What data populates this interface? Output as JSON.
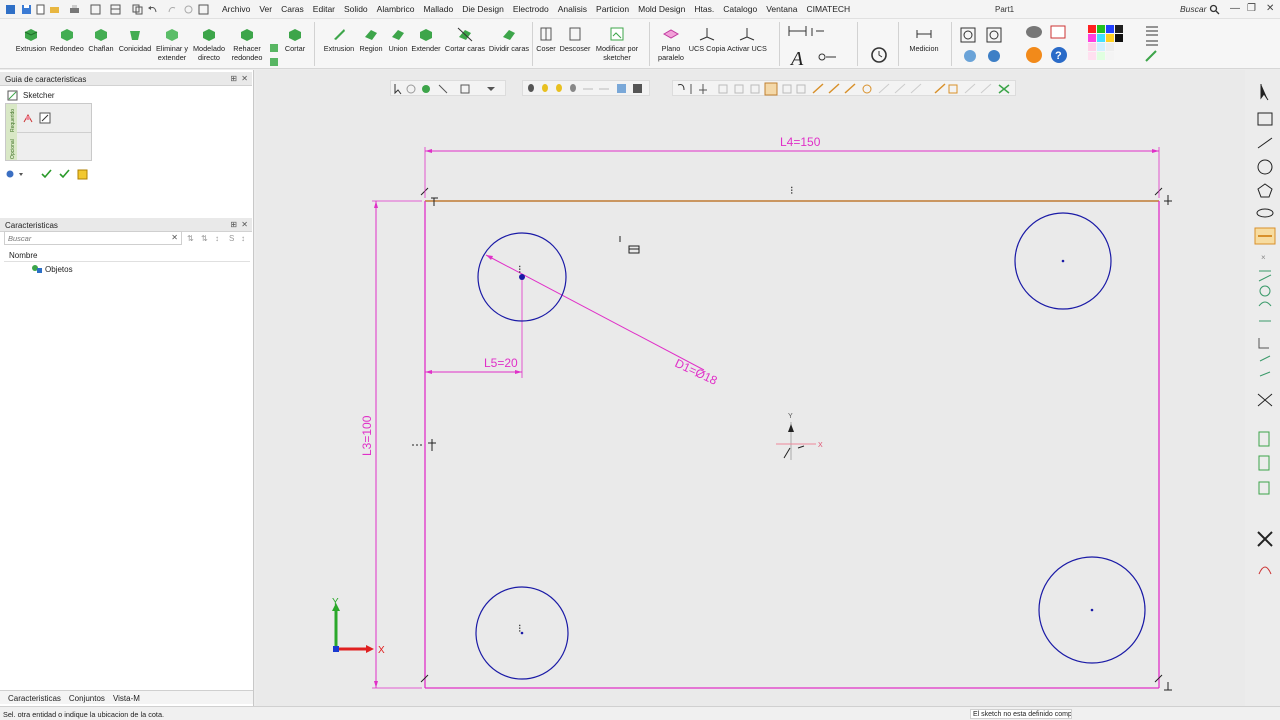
{
  "menu": {
    "items": [
      "Archivo",
      "Ver",
      "Caras",
      "Editar",
      "Solido",
      "Alambrico",
      "Mallado",
      "Die Design",
      "Electrodo",
      "Analisis",
      "Particion",
      "Mold Design",
      "Htas.",
      "Catalogo",
      "Ventana",
      "CIMATECH"
    ],
    "doc_title": "Part1",
    "search_label": "Buscar"
  },
  "ribbon": {
    "extrusion": "Extrusion",
    "redondeo": "Redondeo",
    "chaflan": "Chaflan",
    "conicidad": "Conicidad",
    "eliminar": "Eliminar y extender",
    "modelado": "Modelado directo",
    "rehacer": "Rehacer redondeo",
    "cortar": "Cortar",
    "extrusion2": "Extrusion",
    "region": "Region",
    "union": "Union",
    "extender": "Extender",
    "cortar_caras": "Cortar caras",
    "dividir_caras": "Dividir caras",
    "coser": "Coser",
    "descoser": "Descoser",
    "modificar": "Modificar por sketcher",
    "plano": "Plano paralelo",
    "ucs_copia": "UCS Copia",
    "activar_ucs": "Activar UCS",
    "medicion": "Medicion"
  },
  "left": {
    "guide_title": "Guia de caracteristicas",
    "sketcher": "Sketcher",
    "strip_top": "Requerido",
    "strip_bottom": "Opcional",
    "features_title": "Caracteristicas",
    "search_placeholder": "Buscar",
    "tree_header": "Nombre",
    "tree_root": "Objetos",
    "tabs": [
      "Caracteristicas",
      "Conjuntos",
      "Vista-M"
    ]
  },
  "sketch": {
    "dim_l4": "L4=150",
    "dim_l3": "L3=100",
    "dim_l5": "L5=20",
    "dim_d1": "D1=Ø18",
    "axis_x": "X",
    "axis_y": "Y",
    "origin_x": "X",
    "origin_y": "Y",
    "colors": {
      "magenta": "#e030c8",
      "circle": "#1a1aa6",
      "edge": "#b8650f"
    }
  },
  "status": {
    "message": "Sel. otra entidad o indique la ubicacion de la cota.",
    "right": "El sketch no esta definido completamente"
  }
}
